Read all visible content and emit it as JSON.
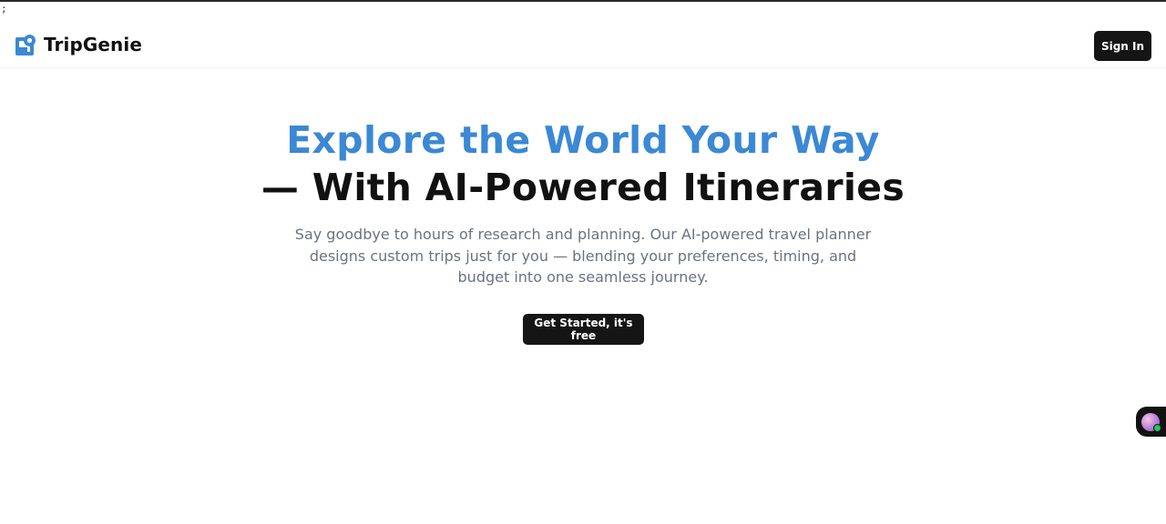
{
  "page": {
    "stray_text": ";"
  },
  "header": {
    "brand_name": "TripGenie",
    "brand_icon": "tripgenie-logo-icon",
    "signin_label": "Sign In"
  },
  "hero": {
    "title_line_1": "Explore the World Your Way",
    "title_line_2": "— With AI-Powered Itineraries",
    "subtitle": "Say goodbye to hours of research and planning. Our AI-powered travel planner designs custom trips just for you — blending your preferences, timing, and budget into one seamless journey.",
    "cta_label": "Get Started, it's free"
  },
  "chat_widget": {
    "icon": "chat-assistant-avatar-icon",
    "status": "online"
  },
  "colors": {
    "accent_blue": "#3b88d4",
    "button_dark": "#151515",
    "heading_dark": "#111111",
    "subtitle_gray": "#6b7280",
    "status_green": "#22c55e"
  }
}
